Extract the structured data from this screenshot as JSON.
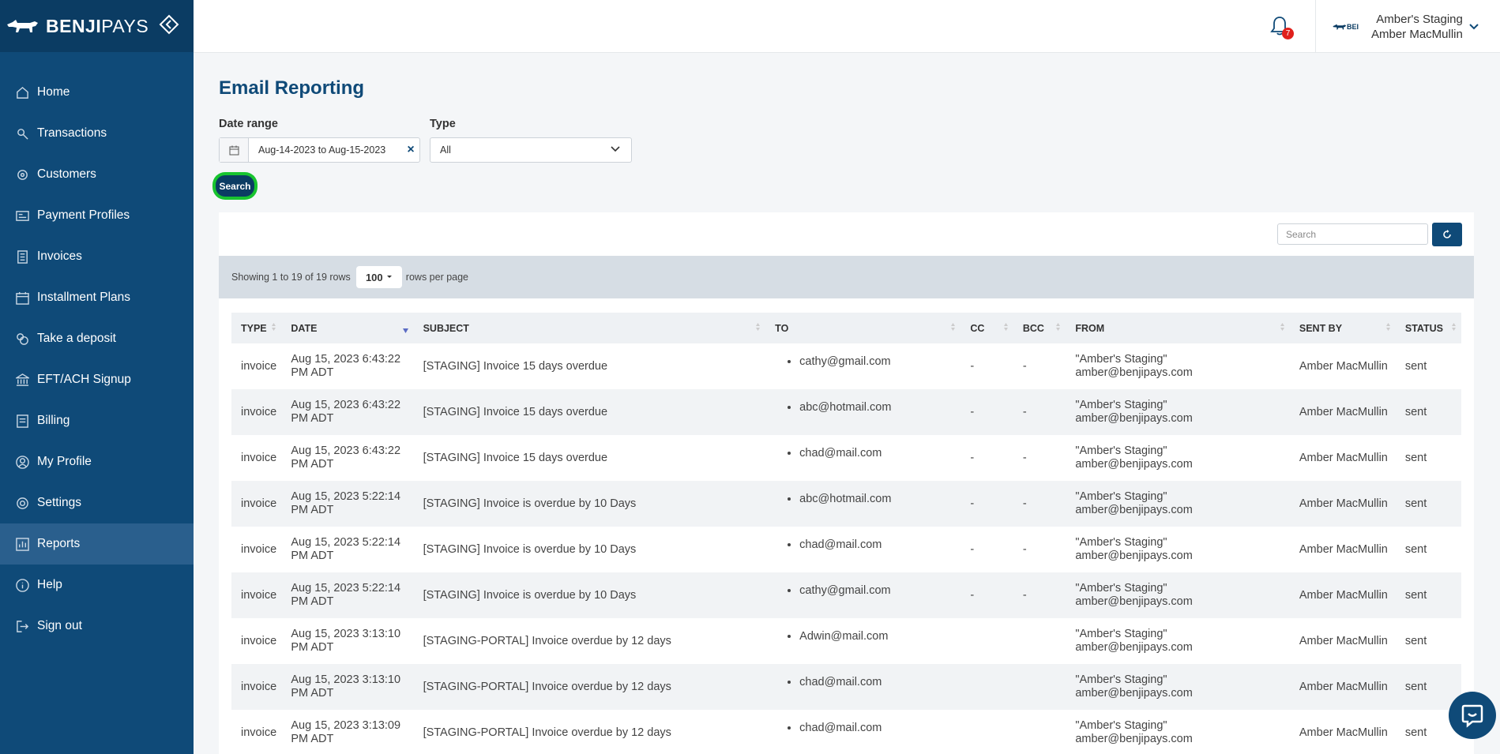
{
  "brand": {
    "name_bold": "BENJI",
    "name_light": "PAYS"
  },
  "nav": [
    {
      "label": "Home",
      "icon": "home-icon"
    },
    {
      "label": "Transactions",
      "icon": "transactions-icon"
    },
    {
      "label": "Customers",
      "icon": "customers-icon"
    },
    {
      "label": "Payment Profiles",
      "icon": "payment-profiles-icon"
    },
    {
      "label": "Invoices",
      "icon": "invoices-icon"
    },
    {
      "label": "Installment Plans",
      "icon": "calendar-icon"
    },
    {
      "label": "Take a deposit",
      "icon": "deposit-icon"
    },
    {
      "label": "EFT/ACH Signup",
      "icon": "bank-icon"
    },
    {
      "label": "Billing",
      "icon": "billing-icon"
    },
    {
      "label": "My Profile",
      "icon": "profile-icon"
    },
    {
      "label": "Settings",
      "icon": "gear-icon"
    },
    {
      "label": "Reports",
      "icon": "reports-icon",
      "active": true
    },
    {
      "label": "Help",
      "icon": "info-icon"
    },
    {
      "label": "Sign out",
      "icon": "sign-out-icon"
    }
  ],
  "header": {
    "notifications_count": "7",
    "account_logo": "BEI",
    "account_name": "Amber's Staging",
    "user_name": "Amber MacMullin"
  },
  "page": {
    "title": "Email Reporting",
    "date_range_label": "Date range",
    "date_range_value": "Aug-14-2023 to Aug-15-2023",
    "type_label": "Type",
    "type_value": "All",
    "search_button": "Search"
  },
  "table": {
    "search_placeholder": "Search",
    "showing_text": "Showing 1 to 19 of 19 rows",
    "rows_per_page": "100",
    "rows_per_page_suffix": "rows per page",
    "columns": [
      "TYPE",
      "DATE",
      "SUBJECT",
      "TO",
      "CC",
      "BCC",
      "FROM",
      "SENT BY",
      "STATUS"
    ],
    "rows": [
      {
        "type": "invoice",
        "date": "Aug 15, 2023 6:43:22 PM ADT",
        "subject": "[STAGING] Invoice 15 days overdue",
        "to": "cathy@gmail.com",
        "cc": "-",
        "bcc": "-",
        "from_name": "\"Amber's Staging\"",
        "from_email": "amber@benjipays.com",
        "sent_by": "Amber MacMullin",
        "status": "sent"
      },
      {
        "type": "invoice",
        "date": "Aug 15, 2023 6:43:22 PM ADT",
        "subject": "[STAGING] Invoice 15 days overdue",
        "to": "abc@hotmail.com",
        "cc": "-",
        "bcc": "-",
        "from_name": "\"Amber's Staging\"",
        "from_email": "amber@benjipays.com",
        "sent_by": "Amber MacMullin",
        "status": "sent"
      },
      {
        "type": "invoice",
        "date": "Aug 15, 2023 6:43:22 PM ADT",
        "subject": "[STAGING] Invoice 15 days overdue",
        "to": "chad@mail.com",
        "cc": "-",
        "bcc": "-",
        "from_name": "\"Amber's Staging\"",
        "from_email": "amber@benjipays.com",
        "sent_by": "Amber MacMullin",
        "status": "sent"
      },
      {
        "type": "invoice",
        "date": "Aug 15, 2023 5:22:14 PM ADT",
        "subject": "[STAGING] Invoice is overdue by 10 Days",
        "to": "abc@hotmail.com",
        "cc": "-",
        "bcc": "-",
        "from_name": "\"Amber's Staging\"",
        "from_email": "amber@benjipays.com",
        "sent_by": "Amber MacMullin",
        "status": "sent"
      },
      {
        "type": "invoice",
        "date": "Aug 15, 2023 5:22:14 PM ADT",
        "subject": "[STAGING] Invoice is overdue by 10 Days",
        "to": "chad@mail.com",
        "cc": "-",
        "bcc": "-",
        "from_name": "\"Amber's Staging\"",
        "from_email": "amber@benjipays.com",
        "sent_by": "Amber MacMullin",
        "status": "sent"
      },
      {
        "type": "invoice",
        "date": "Aug 15, 2023 5:22:14 PM ADT",
        "subject": "[STAGING] Invoice is overdue by 10 Days",
        "to": "cathy@gmail.com",
        "cc": "-",
        "bcc": "-",
        "from_name": "\"Amber's Staging\"",
        "from_email": "amber@benjipays.com",
        "sent_by": "Amber MacMullin",
        "status": "sent"
      },
      {
        "type": "invoice",
        "date": "Aug 15, 2023 3:13:10 PM ADT",
        "subject": "[STAGING-PORTAL] Invoice overdue by 12 days",
        "to": "Adwin@mail.com",
        "cc": "",
        "bcc": "",
        "from_name": "\"Amber's Staging\"",
        "from_email": "amber@benjipays.com",
        "sent_by": "Amber MacMullin",
        "status": "sent"
      },
      {
        "type": "invoice",
        "date": "Aug 15, 2023 3:13:10 PM ADT",
        "subject": "[STAGING-PORTAL] Invoice overdue by 12 days",
        "to": "chad@mail.com",
        "cc": "",
        "bcc": "",
        "from_name": "\"Amber's Staging\"",
        "from_email": "amber@benjipays.com",
        "sent_by": "Amber MacMullin",
        "status": "sent"
      },
      {
        "type": "invoice",
        "date": "Aug 15, 2023 3:13:09 PM ADT",
        "subject": "[STAGING-PORTAL] Invoice overdue by 12 days",
        "to": "chad@mail.com",
        "cc": "",
        "bcc": "",
        "from_name": "\"Amber's Staging\"",
        "from_email": "amber@benjipays.com",
        "sent_by": "Amber MacMullin",
        "status": "sent"
      }
    ]
  },
  "colors": {
    "sidebar": "#0f4a78",
    "sidebar_header": "#0b3c63",
    "active_nav": "#2a5f8d",
    "accent_green": "#18c42f",
    "badge_red": "#e0201c"
  }
}
